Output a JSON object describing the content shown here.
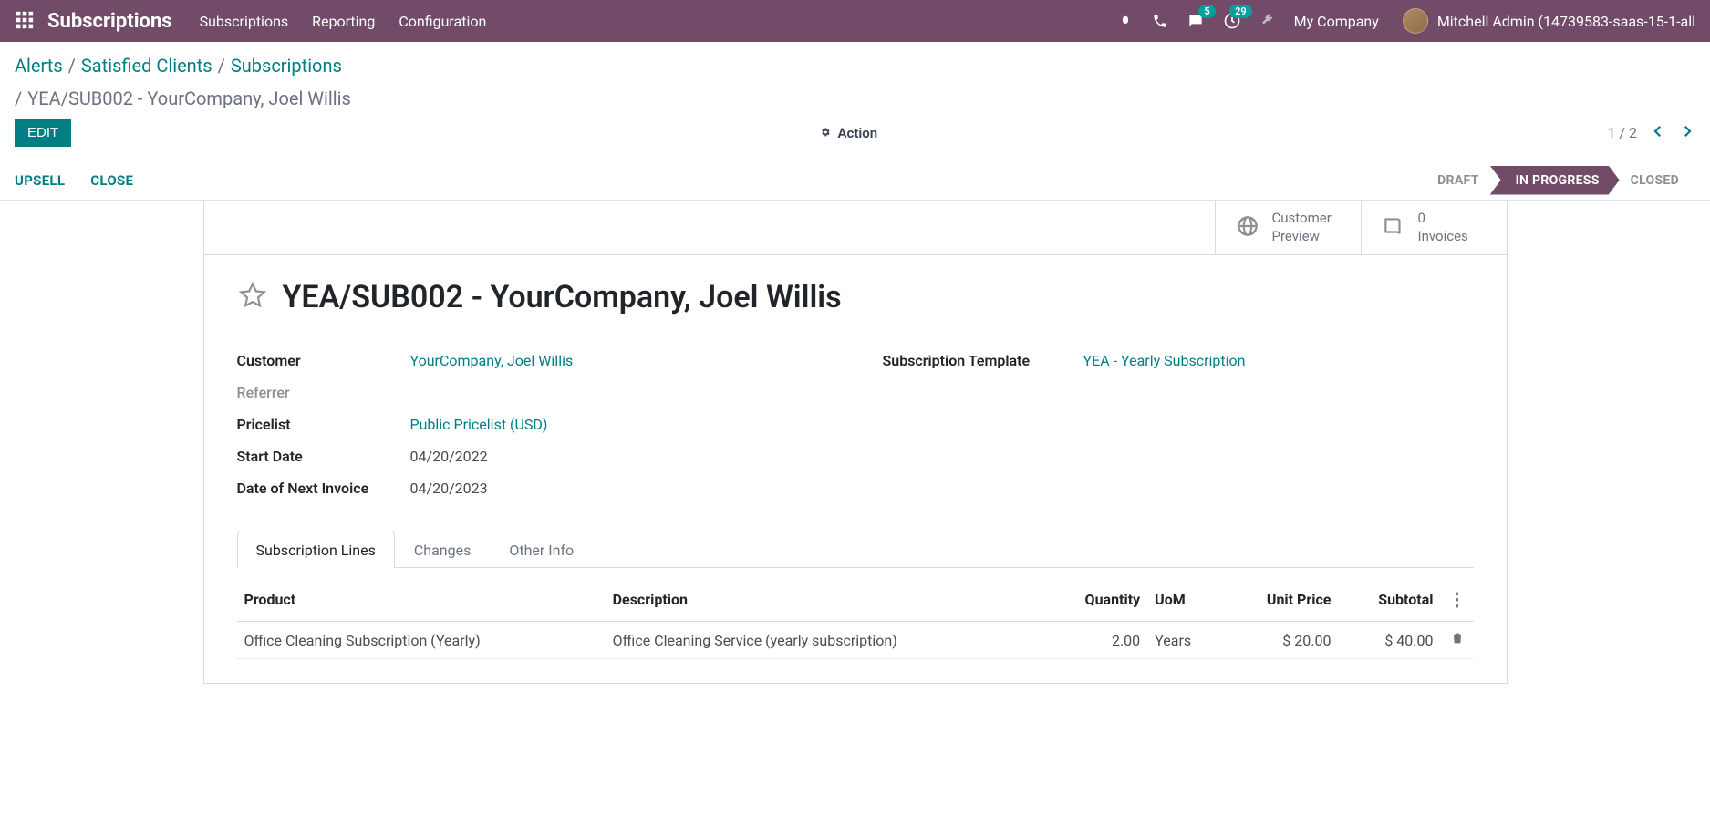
{
  "navbar": {
    "brand": "Subscriptions",
    "menus": [
      "Subscriptions",
      "Reporting",
      "Configuration"
    ],
    "msg_badge": "5",
    "activity_badge": "29",
    "company": "My Company",
    "username": "Mitchell Admin (14739583-saas-15-1-all"
  },
  "breadcrumbs": {
    "items": [
      "Alerts",
      "Satisfied Clients",
      "Subscriptions"
    ],
    "current": "YEA/SUB002 - YourCompany, Joel Willis"
  },
  "controls": {
    "edit": "EDIT",
    "action": "Action",
    "pager": "1 / 2"
  },
  "statusbar": {
    "upsell": "UPSELL",
    "close": "CLOSE",
    "stages": {
      "draft": "DRAFT",
      "in_progress": "IN PROGRESS",
      "closed": "CLOSED"
    }
  },
  "buttonbox": {
    "preview_l1": "Customer",
    "preview_l2": "Preview",
    "invoices_count": "0",
    "invoices_label": "Invoices"
  },
  "record": {
    "title": "YEA/SUB002 - YourCompany, Joel Willis",
    "fields_left": {
      "customer_label": "Customer",
      "customer_value": "YourCompany, Joel Willis",
      "referrer_label": "Referrer",
      "pricelist_label": "Pricelist",
      "pricelist_value": "Public Pricelist (USD)",
      "start_label": "Start Date",
      "start_value": "04/20/2022",
      "next_inv_label": "Date of Next Invoice",
      "next_inv_value": "04/20/2023"
    },
    "fields_right": {
      "template_label": "Subscription Template",
      "template_value": "YEA - Yearly Subscription"
    }
  },
  "tabs": {
    "lines": "Subscription Lines",
    "changes": "Changes",
    "other": "Other Info"
  },
  "table": {
    "headers": {
      "product": "Product",
      "description": "Description",
      "quantity": "Quantity",
      "uom": "UoM",
      "unit_price": "Unit Price",
      "subtotal": "Subtotal"
    },
    "rows": [
      {
        "product": "Office Cleaning Subscription (Yearly)",
        "description": "Office Cleaning Service (yearly subscription)",
        "quantity": "2.00",
        "uom": "Years",
        "unit_price": "$ 20.00",
        "subtotal": "$ 40.00"
      }
    ]
  }
}
